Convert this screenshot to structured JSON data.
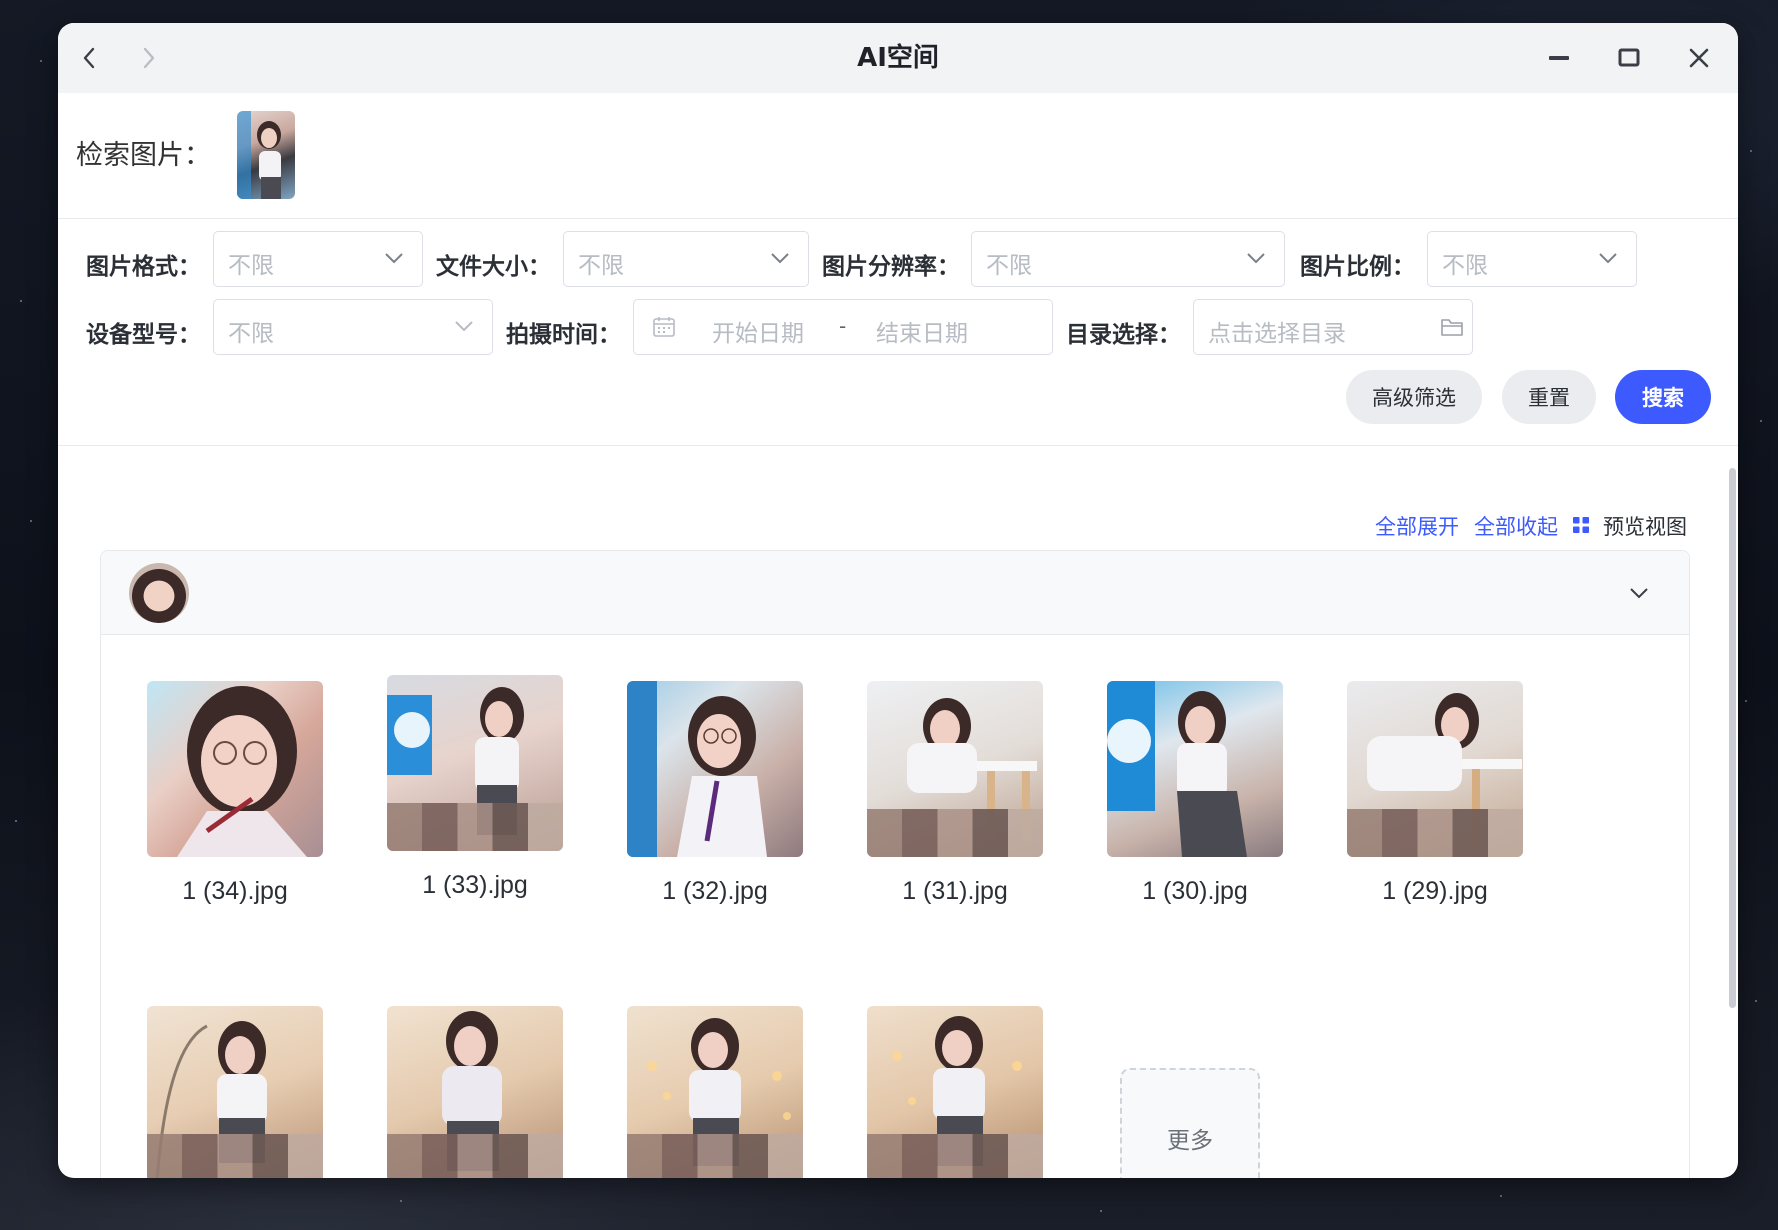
{
  "window": {
    "title": "AI空间"
  },
  "query": {
    "label": "检索图片："
  },
  "filters": {
    "format": {
      "label": "图片格式：",
      "value": "不限"
    },
    "size": {
      "label": "文件大小：",
      "value": "不限"
    },
    "resolution": {
      "label": "图片分辨率：",
      "value": "不限"
    },
    "ratio": {
      "label": "图片比例：",
      "value": "不限"
    },
    "device": {
      "label": "设备型号：",
      "value": "不限"
    },
    "time": {
      "label": "拍摄时间：",
      "start_placeholder": "开始日期",
      "separator": "-",
      "end_placeholder": "结束日期"
    },
    "directory": {
      "label": "目录选择：",
      "placeholder": "点击选择目录"
    }
  },
  "buttons": {
    "advanced": "高级筛选",
    "reset": "重置",
    "search": "搜索"
  },
  "toolbar": {
    "expand_all": "全部展开",
    "collapse_all": "全部收起",
    "preview_view": "预览视图"
  },
  "results": {
    "images": [
      {
        "name": "1 (34).jpg"
      },
      {
        "name": "1 (33).jpg"
      },
      {
        "name": "1 (32).jpg"
      },
      {
        "name": "1 (31).jpg"
      },
      {
        "name": "1 (30).jpg"
      },
      {
        "name": "1 (29).jpg"
      }
    ],
    "more_label": "更多"
  },
  "colors": {
    "accent": "#3d5afe",
    "title_text": "#1f2329",
    "placeholder": "#b7bbc3"
  }
}
